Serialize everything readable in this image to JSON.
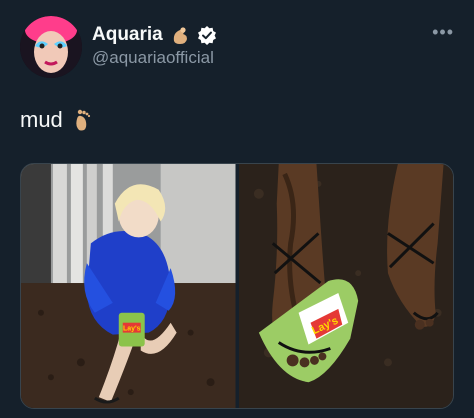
{
  "tweet": {
    "author": {
      "display_name": "Aquaria",
      "handle": "@aquariaofficial",
      "name_emoji": "pinching-hand-emoji",
      "verified_badge": "verified-icon"
    },
    "more_label": "•••",
    "text": "mud",
    "text_emoji": "foot-emoji",
    "media": [
      {
        "icon": "photo-person-blue-fur-coat",
        "bag_label": "Lay's"
      },
      {
        "icon": "photo-muddy-feet-sandals",
        "bag_label": "Lay's"
      }
    ]
  },
  "colors": {
    "background": "#15202b",
    "primary_text": "#f7f9f9",
    "secondary_text": "#8b98a5",
    "verified_fill": "#ffffff"
  }
}
